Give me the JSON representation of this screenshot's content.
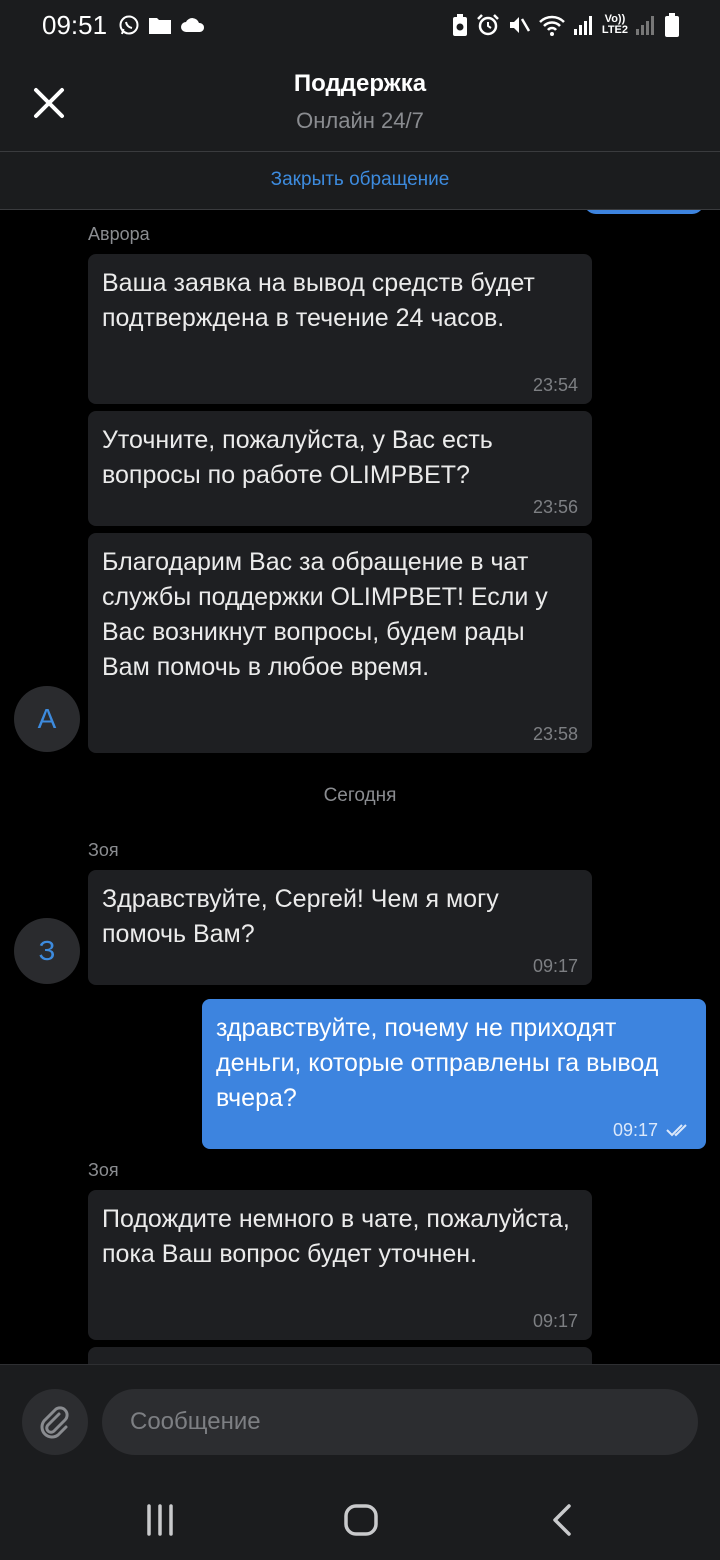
{
  "status_bar": {
    "time": "09:51",
    "left_icons": [
      "whatsapp-icon",
      "folder-icon",
      "cloud-icon"
    ],
    "right_icons": [
      "battery-saver-icon",
      "alarm-icon",
      "mute-icon",
      "wifi-icon",
      "signal-icon",
      "volte-icon",
      "signal-2-icon",
      "battery-icon"
    ],
    "network_label": "LTE2"
  },
  "header": {
    "title": "Поддержка",
    "subtitle": "Онлайн 24/7"
  },
  "close_ticket": {
    "label": "Закрыть обращение",
    "color": "#3d8bde"
  },
  "chat": {
    "accent_color": "#3d84df",
    "groups": [
      {
        "sender": "Аврора",
        "avatar_letter": "А",
        "messages": [
          {
            "text": "Ваша заявка на вывод средств будет подтверждена в течение 24 часов.",
            "time": "23:54"
          },
          {
            "text": "Уточните, пожалуйста, у Вас есть вопросы по работе OLIMPBET?",
            "time": "23:56"
          },
          {
            "text": "Благодарим Вас за обращение в чат службы поддержки OLIMPBET! Если у Вас возникнут вопросы, будем рады Вам помочь в любое время.",
            "time": "23:58"
          }
        ]
      },
      {
        "date_separator": "Сегодня",
        "sender": "Зоя",
        "avatar_letter": "З",
        "messages": [
          {
            "text": "Здравствуйте, Сергей! Чем я могу помочь Вам?",
            "time": "09:17"
          }
        ]
      },
      {
        "outgoing": true,
        "messages": [
          {
            "text": "здравствуйте, почему не приходят деньги, которые отправлены га вывод вчера?",
            "time": "09:17",
            "status": "read"
          }
        ]
      },
      {
        "sender": "Зоя",
        "messages": [
          {
            "text": "Подождите немного в чате, пожалуйста, пока Ваш вопрос будет уточнен.",
            "time": "09:17"
          }
        ]
      }
    ]
  },
  "composer": {
    "placeholder": "Сообщение",
    "attach_icon": "paperclip-icon"
  },
  "navbar": {
    "icons": [
      "recents-icon",
      "home-icon",
      "back-icon"
    ]
  }
}
